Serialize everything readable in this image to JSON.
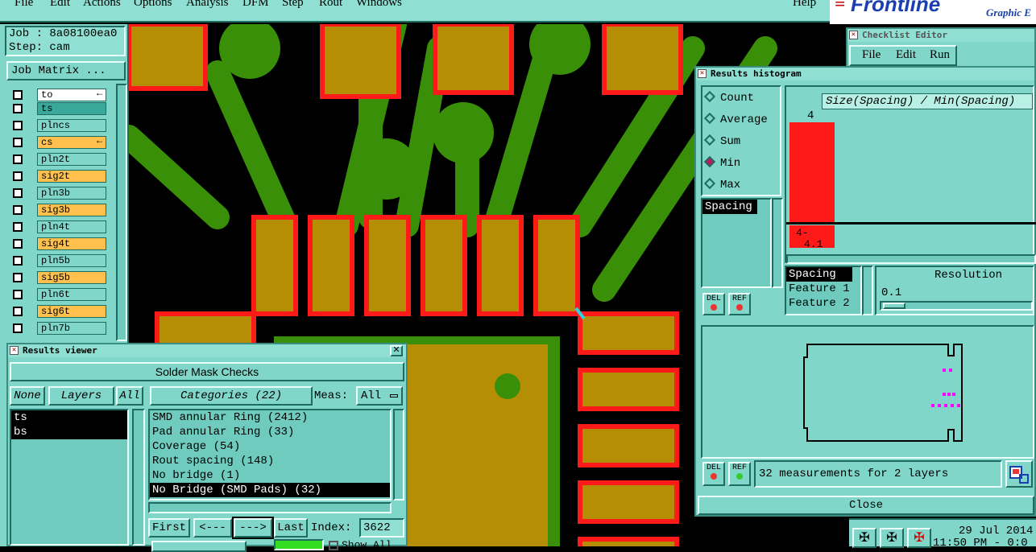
{
  "menu": [
    "File",
    "Edit",
    "Actions",
    "Options",
    "Analysis",
    "DFM",
    "Step",
    "Rout",
    "Windows",
    "Help"
  ],
  "logo": {
    "brand": "Frontline",
    "tagline": "Graphic E"
  },
  "job": {
    "job_line": "Job : 8a08100ea0",
    "step_line": "Step: cam",
    "matrix_button": "Job Matrix ..."
  },
  "layers": [
    {
      "name": "to",
      "color": "#ffffff",
      "flag": "←"
    },
    {
      "name": "ts",
      "color": "#3aa89a",
      "flag": ""
    },
    {
      "name": "plncs",
      "color": "#7fd6c9",
      "flag": ""
    },
    {
      "name": "cs",
      "color": "#ffc04d",
      "flag": "←"
    },
    {
      "name": "pln2t",
      "color": "#7fd6c9",
      "flag": ""
    },
    {
      "name": "sig2t",
      "color": "#ffc04d",
      "flag": ""
    },
    {
      "name": "pln3b",
      "color": "#7fd6c9",
      "flag": ""
    },
    {
      "name": "sig3b",
      "color": "#ffc04d",
      "flag": ""
    },
    {
      "name": "pln4t",
      "color": "#7fd6c9",
      "flag": ""
    },
    {
      "name": "sig4t",
      "color": "#ffc04d",
      "flag": ""
    },
    {
      "name": "pln5b",
      "color": "#7fd6c9",
      "flag": ""
    },
    {
      "name": "sig5b",
      "color": "#ffc04d",
      "flag": ""
    },
    {
      "name": "pln6t",
      "color": "#7fd6c9",
      "flag": ""
    },
    {
      "name": "sig6t",
      "color": "#ffc04d",
      "flag": ""
    },
    {
      "name": "pln7b",
      "color": "#7fd6c9",
      "flag": ""
    }
  ],
  "results_viewer": {
    "title": "Results viewer",
    "header": "Solder Mask Checks",
    "none_btn": "None",
    "layers_btn": "Layers",
    "all_btn": "All",
    "categories_btn": "Categories (22)",
    "meas_label": "Meas:",
    "meas_value": "All",
    "layer_list": [
      "ts",
      "bs"
    ],
    "categories": [
      "SMD annular Ring (2412)",
      "Pad annular Ring (33)",
      "Coverage (54)",
      "Rout spacing (148)",
      "No bridge (1)",
      "No Bridge (SMD Pads) (32)"
    ],
    "first_btn": "First",
    "prev_btn": "<---",
    "next_btn": "--->",
    "last_btn": "Last",
    "index_label": "Index:",
    "index_value": "3622",
    "show_all": "Show All"
  },
  "checklist": {
    "title": "Checklist Editor",
    "menu": [
      "File",
      "Edit",
      "Run"
    ]
  },
  "histogram": {
    "title": "Results histogram",
    "modes": [
      "Count",
      "Average",
      "Sum",
      "Min",
      "Max"
    ],
    "selected_mode": "Min",
    "graph_title": "Size(Spacing) / Min(Spacing)",
    "top_count": "4",
    "bar_label_1": "4-",
    "bar_label_2": "4.1",
    "measure_list": [
      "Spacing"
    ],
    "fields": [
      "Spacing",
      "Feature 1",
      "Feature 2"
    ],
    "resolution_label": "Resolution",
    "resolution_value": "0.1",
    "del_btn": "DEL",
    "ref_btn": "REF",
    "status": "32 measurements for 2 layers",
    "close_btn": "Close"
  },
  "clock": {
    "date": "29 Jul 2014",
    "time": "11:50 PM - 0:0"
  }
}
